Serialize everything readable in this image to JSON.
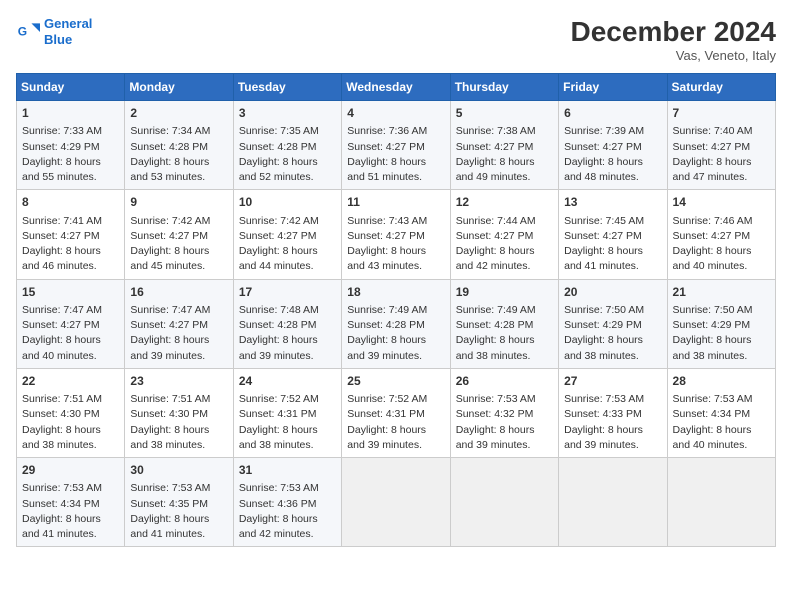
{
  "header": {
    "logo_line1": "General",
    "logo_line2": "Blue",
    "month": "December 2024",
    "location": "Vas, Veneto, Italy"
  },
  "weekdays": [
    "Sunday",
    "Monday",
    "Tuesday",
    "Wednesday",
    "Thursday",
    "Friday",
    "Saturday"
  ],
  "weeks": [
    [
      {
        "day": "1",
        "sunrise": "Sunrise: 7:33 AM",
        "sunset": "Sunset: 4:29 PM",
        "daylight": "Daylight: 8 hours and 55 minutes."
      },
      {
        "day": "2",
        "sunrise": "Sunrise: 7:34 AM",
        "sunset": "Sunset: 4:28 PM",
        "daylight": "Daylight: 8 hours and 53 minutes."
      },
      {
        "day": "3",
        "sunrise": "Sunrise: 7:35 AM",
        "sunset": "Sunset: 4:28 PM",
        "daylight": "Daylight: 8 hours and 52 minutes."
      },
      {
        "day": "4",
        "sunrise": "Sunrise: 7:36 AM",
        "sunset": "Sunset: 4:27 PM",
        "daylight": "Daylight: 8 hours and 51 minutes."
      },
      {
        "day": "5",
        "sunrise": "Sunrise: 7:38 AM",
        "sunset": "Sunset: 4:27 PM",
        "daylight": "Daylight: 8 hours and 49 minutes."
      },
      {
        "day": "6",
        "sunrise": "Sunrise: 7:39 AM",
        "sunset": "Sunset: 4:27 PM",
        "daylight": "Daylight: 8 hours and 48 minutes."
      },
      {
        "day": "7",
        "sunrise": "Sunrise: 7:40 AM",
        "sunset": "Sunset: 4:27 PM",
        "daylight": "Daylight: 8 hours and 47 minutes."
      }
    ],
    [
      {
        "day": "8",
        "sunrise": "Sunrise: 7:41 AM",
        "sunset": "Sunset: 4:27 PM",
        "daylight": "Daylight: 8 hours and 46 minutes."
      },
      {
        "day": "9",
        "sunrise": "Sunrise: 7:42 AM",
        "sunset": "Sunset: 4:27 PM",
        "daylight": "Daylight: 8 hours and 45 minutes."
      },
      {
        "day": "10",
        "sunrise": "Sunrise: 7:42 AM",
        "sunset": "Sunset: 4:27 PM",
        "daylight": "Daylight: 8 hours and 44 minutes."
      },
      {
        "day": "11",
        "sunrise": "Sunrise: 7:43 AM",
        "sunset": "Sunset: 4:27 PM",
        "daylight": "Daylight: 8 hours and 43 minutes."
      },
      {
        "day": "12",
        "sunrise": "Sunrise: 7:44 AM",
        "sunset": "Sunset: 4:27 PM",
        "daylight": "Daylight: 8 hours and 42 minutes."
      },
      {
        "day": "13",
        "sunrise": "Sunrise: 7:45 AM",
        "sunset": "Sunset: 4:27 PM",
        "daylight": "Daylight: 8 hours and 41 minutes."
      },
      {
        "day": "14",
        "sunrise": "Sunrise: 7:46 AM",
        "sunset": "Sunset: 4:27 PM",
        "daylight": "Daylight: 8 hours and 40 minutes."
      }
    ],
    [
      {
        "day": "15",
        "sunrise": "Sunrise: 7:47 AM",
        "sunset": "Sunset: 4:27 PM",
        "daylight": "Daylight: 8 hours and 40 minutes."
      },
      {
        "day": "16",
        "sunrise": "Sunrise: 7:47 AM",
        "sunset": "Sunset: 4:27 PM",
        "daylight": "Daylight: 8 hours and 39 minutes."
      },
      {
        "day": "17",
        "sunrise": "Sunrise: 7:48 AM",
        "sunset": "Sunset: 4:28 PM",
        "daylight": "Daylight: 8 hours and 39 minutes."
      },
      {
        "day": "18",
        "sunrise": "Sunrise: 7:49 AM",
        "sunset": "Sunset: 4:28 PM",
        "daylight": "Daylight: 8 hours and 39 minutes."
      },
      {
        "day": "19",
        "sunrise": "Sunrise: 7:49 AM",
        "sunset": "Sunset: 4:28 PM",
        "daylight": "Daylight: 8 hours and 38 minutes."
      },
      {
        "day": "20",
        "sunrise": "Sunrise: 7:50 AM",
        "sunset": "Sunset: 4:29 PM",
        "daylight": "Daylight: 8 hours and 38 minutes."
      },
      {
        "day": "21",
        "sunrise": "Sunrise: 7:50 AM",
        "sunset": "Sunset: 4:29 PM",
        "daylight": "Daylight: 8 hours and 38 minutes."
      }
    ],
    [
      {
        "day": "22",
        "sunrise": "Sunrise: 7:51 AM",
        "sunset": "Sunset: 4:30 PM",
        "daylight": "Daylight: 8 hours and 38 minutes."
      },
      {
        "day": "23",
        "sunrise": "Sunrise: 7:51 AM",
        "sunset": "Sunset: 4:30 PM",
        "daylight": "Daylight: 8 hours and 38 minutes."
      },
      {
        "day": "24",
        "sunrise": "Sunrise: 7:52 AM",
        "sunset": "Sunset: 4:31 PM",
        "daylight": "Daylight: 8 hours and 38 minutes."
      },
      {
        "day": "25",
        "sunrise": "Sunrise: 7:52 AM",
        "sunset": "Sunset: 4:31 PM",
        "daylight": "Daylight: 8 hours and 39 minutes."
      },
      {
        "day": "26",
        "sunrise": "Sunrise: 7:53 AM",
        "sunset": "Sunset: 4:32 PM",
        "daylight": "Daylight: 8 hours and 39 minutes."
      },
      {
        "day": "27",
        "sunrise": "Sunrise: 7:53 AM",
        "sunset": "Sunset: 4:33 PM",
        "daylight": "Daylight: 8 hours and 39 minutes."
      },
      {
        "day": "28",
        "sunrise": "Sunrise: 7:53 AM",
        "sunset": "Sunset: 4:34 PM",
        "daylight": "Daylight: 8 hours and 40 minutes."
      }
    ],
    [
      {
        "day": "29",
        "sunrise": "Sunrise: 7:53 AM",
        "sunset": "Sunset: 4:34 PM",
        "daylight": "Daylight: 8 hours and 41 minutes."
      },
      {
        "day": "30",
        "sunrise": "Sunrise: 7:53 AM",
        "sunset": "Sunset: 4:35 PM",
        "daylight": "Daylight: 8 hours and 41 minutes."
      },
      {
        "day": "31",
        "sunrise": "Sunrise: 7:53 AM",
        "sunset": "Sunset: 4:36 PM",
        "daylight": "Daylight: 8 hours and 42 minutes."
      },
      null,
      null,
      null,
      null
    ]
  ]
}
